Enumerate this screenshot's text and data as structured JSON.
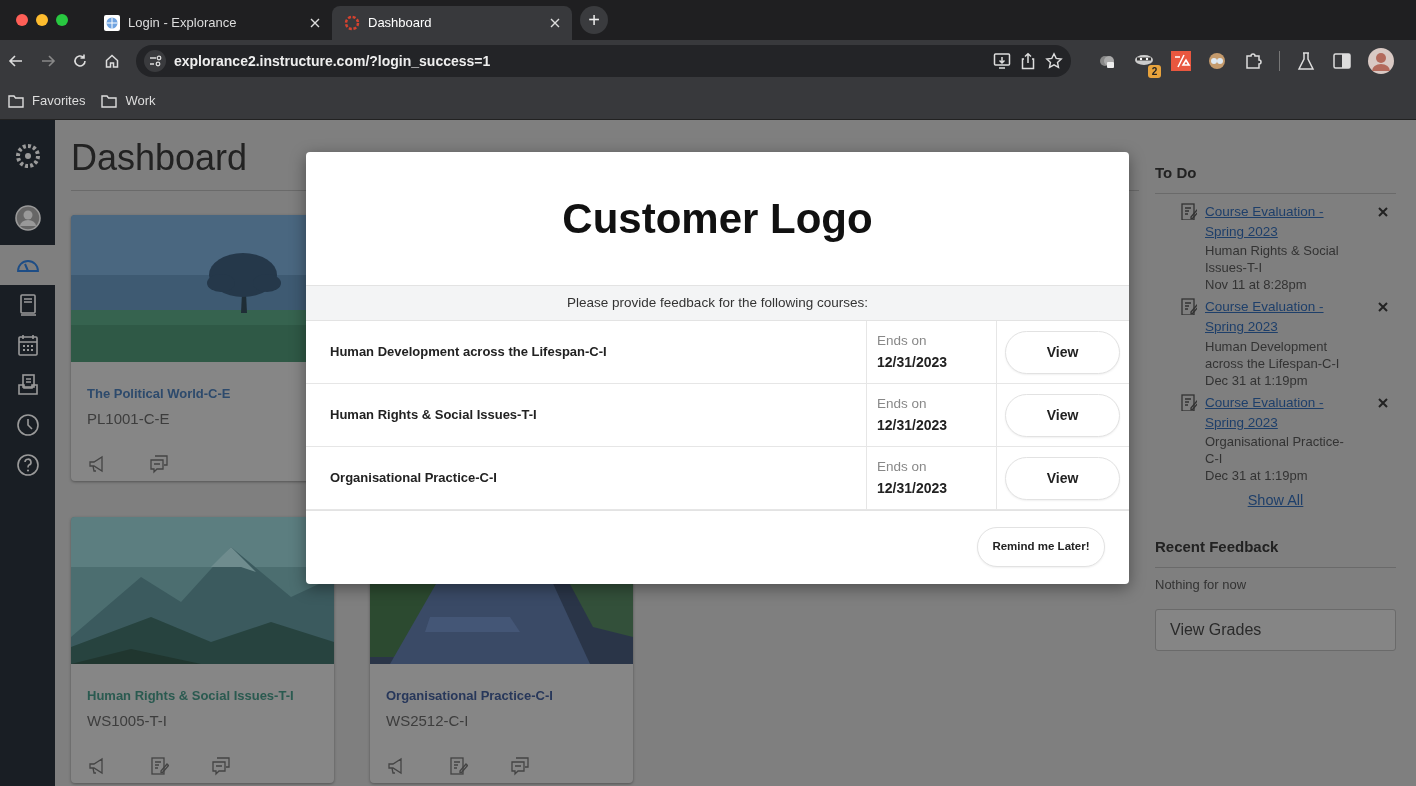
{
  "browser": {
    "tabs": [
      {
        "title": "Login - Explorance",
        "selected": false
      },
      {
        "title": "Dashboard",
        "selected": true
      }
    ],
    "new_tab": "+",
    "url": "explorance2.instructure.com/?login_success=1",
    "extension_badge": "2",
    "bookmarks": [
      "Favorites",
      "Work"
    ]
  },
  "sidebar": {
    "items": [
      {
        "kind": "logo",
        "selected": false
      },
      {
        "kind": "account",
        "selected": false
      },
      {
        "kind": "dashboard",
        "selected": true
      },
      {
        "kind": "courses",
        "selected": false
      },
      {
        "kind": "calendar",
        "selected": false
      },
      {
        "kind": "inbox",
        "selected": false
      },
      {
        "kind": "history",
        "selected": false
      },
      {
        "kind": "help",
        "selected": false
      }
    ]
  },
  "dashboard": {
    "title": "Dashboard",
    "cards": [
      {
        "title": "The Political World-C-E",
        "code": "PL1001-C-E",
        "color": "#2d4a6c",
        "actions": [
          {
            "kind": "announcement"
          },
          {
            "kind": "discussion"
          }
        ]
      },
      {
        "title": "Human Rights & Social Issues-T-I",
        "code": "WS1005-T-I",
        "color": "#2a5a50",
        "actions": [
          {
            "kind": "announcement"
          },
          {
            "kind": "assignment"
          },
          {
            "kind": "discussion"
          }
        ]
      },
      {
        "title": "Organisational Practice-C-I",
        "code": "WS2512-C-I",
        "color": "#27375a",
        "actions": [
          {
            "kind": "announcement"
          },
          {
            "kind": "assignment"
          },
          {
            "kind": "discussion"
          }
        ]
      }
    ]
  },
  "modal": {
    "logo_text": "Customer Logo",
    "prompt": "Please provide feedback for the following courses:",
    "courses": [
      {
        "name": "Human Development across the Lifespan-C-I",
        "ends_label": "Ends on",
        "ends_date": "12/31/2023",
        "button": "View"
      },
      {
        "name": "Human Rights & Social Issues-T-I",
        "ends_label": "Ends on",
        "ends_date": "12/31/2023",
        "button": "View"
      },
      {
        "name": "Organisational Practice-C-I",
        "ends_label": "Ends on",
        "ends_date": "12/31/2023",
        "button": "View"
      }
    ],
    "remind_button": "Remind me Later!"
  },
  "todo": {
    "title": "To Do",
    "items": [
      {
        "link": "Course Evaluation - Spring 2023",
        "course": "Human Rights & Social Issues-T-I",
        "date": "Nov 11 at 8:28pm"
      },
      {
        "link": "Course Evaluation - Spring 2023",
        "course": "Human Development across the Lifespan-C-I",
        "date": "Dec 31 at 1:19pm"
      },
      {
        "link": "Course Evaluation - Spring 2023",
        "course": "Organisational Practice-C-I",
        "date": "Dec 31 at 1:19pm"
      }
    ],
    "show_all": "Show All"
  },
  "recent_feedback": {
    "title": "Recent Feedback",
    "empty_text": "Nothing for now",
    "button": "View Grades"
  }
}
